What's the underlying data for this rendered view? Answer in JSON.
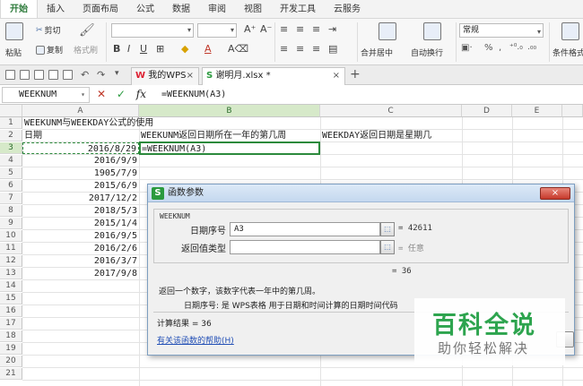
{
  "menu": {
    "items": [
      "开始",
      "插入",
      "页面布局",
      "公式",
      "数据",
      "审阅",
      "视图",
      "开发工具",
      "云服务"
    ]
  },
  "ribbon": {
    "paste": "粘贴",
    "cut": "剪切",
    "copy": "复制",
    "format_painter": "格式刷",
    "merge_center": "合并居中",
    "auto_wrap": "自动换行",
    "number_format": "常规",
    "conditional_format": "条件格式"
  },
  "tabbar": {
    "wps_tab": "我的WPS",
    "file_tab": "谢明月.xlsx *",
    "new_tab": "+"
  },
  "formula_bar": {
    "name_box": "WEEKNUM",
    "fx": "fx",
    "formula": "=WEEKNUM(A3)"
  },
  "grid": {
    "columns": [
      "A",
      "B",
      "C",
      "D",
      "E"
    ],
    "rows": [
      "1",
      "2",
      "3",
      "4",
      "5",
      "6",
      "7",
      "8",
      "9",
      "10",
      "11",
      "12",
      "13",
      "14",
      "15",
      "16",
      "17",
      "18",
      "19",
      "20",
      "21"
    ],
    "a1": "WEEKUNM与WEEKDAY公式的使用",
    "a2": "日期",
    "b2": "WEEKUNM返回日期所在一年的第几周",
    "c2": "WEEKDAY返回日期是星期几",
    "b3": "=WEEKNUM(A3)",
    "dates": [
      "2016/8/29",
      "2016/9/9",
      "1905/7/9",
      "2015/6/9",
      "2017/12/2",
      "2018/5/3",
      "2015/1/4",
      "2016/9/5",
      "2016/2/6",
      "2016/3/7",
      "2017/9/8"
    ]
  },
  "dialog": {
    "title": "函数参数",
    "close": "×",
    "function_name": "WEEKNUM",
    "arg1_label": "日期序号",
    "arg1_value": "A3",
    "arg1_result": "= 42611",
    "arg2_label": "返回值类型",
    "arg2_value": "",
    "arg2_result": "= 任意",
    "formula_result": "= 36",
    "description": "返回一个数字，该数字代表一年中的第几周。",
    "arg_help": "日期序号:   是 WPS表格 用于日期和时间计算的日期时间代码",
    "calc_result": "计算结果 = 36",
    "help_link": "有关该函数的帮助(H)"
  },
  "watermark": {
    "title": "百科全说",
    "subtitle": "助你轻松解决"
  }
}
